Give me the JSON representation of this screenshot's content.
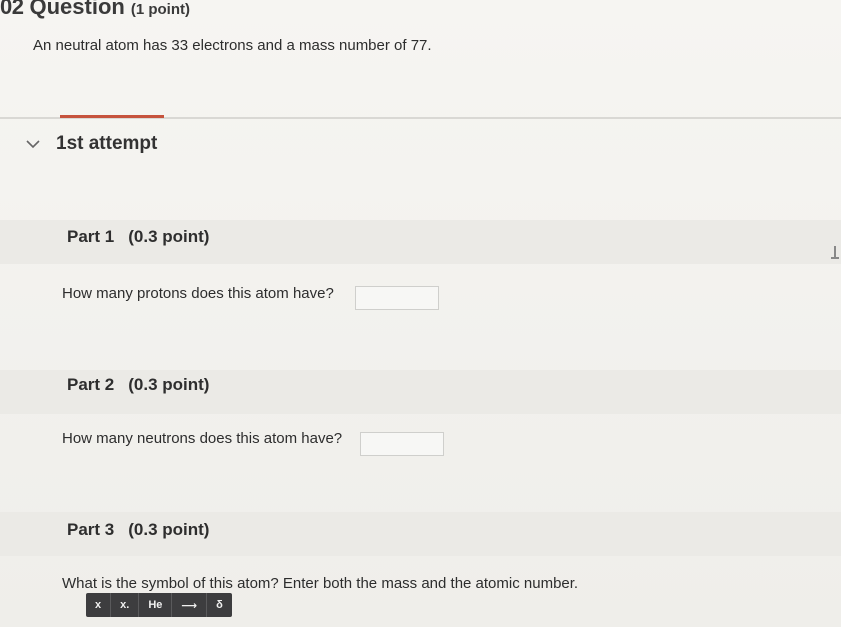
{
  "question": {
    "number": "02",
    "title": "Question",
    "points": "(1 point)",
    "text": "An neutral atom has 33 electrons and a mass number of 77."
  },
  "attempt": {
    "label": "1st attempt"
  },
  "parts": [
    {
      "label": "Part 1",
      "points": "(0.3 point)",
      "question": "How many protons does this atom have?"
    },
    {
      "label": "Part 2",
      "points": "(0.3 point)",
      "question": "How many neutrons does this atom have?"
    },
    {
      "label": "Part 3",
      "points": "(0.3 point)",
      "question": "What is the symbol of this atom? Enter both the mass and the atomic number."
    }
  ],
  "toolbar": {
    "superscript": "x",
    "subscript": "x.",
    "element": "He",
    "arrow": "⟶",
    "delta": "δ"
  },
  "colors": {
    "accent": "#c6533d",
    "toolbar_bg": "#3d3d3f"
  }
}
